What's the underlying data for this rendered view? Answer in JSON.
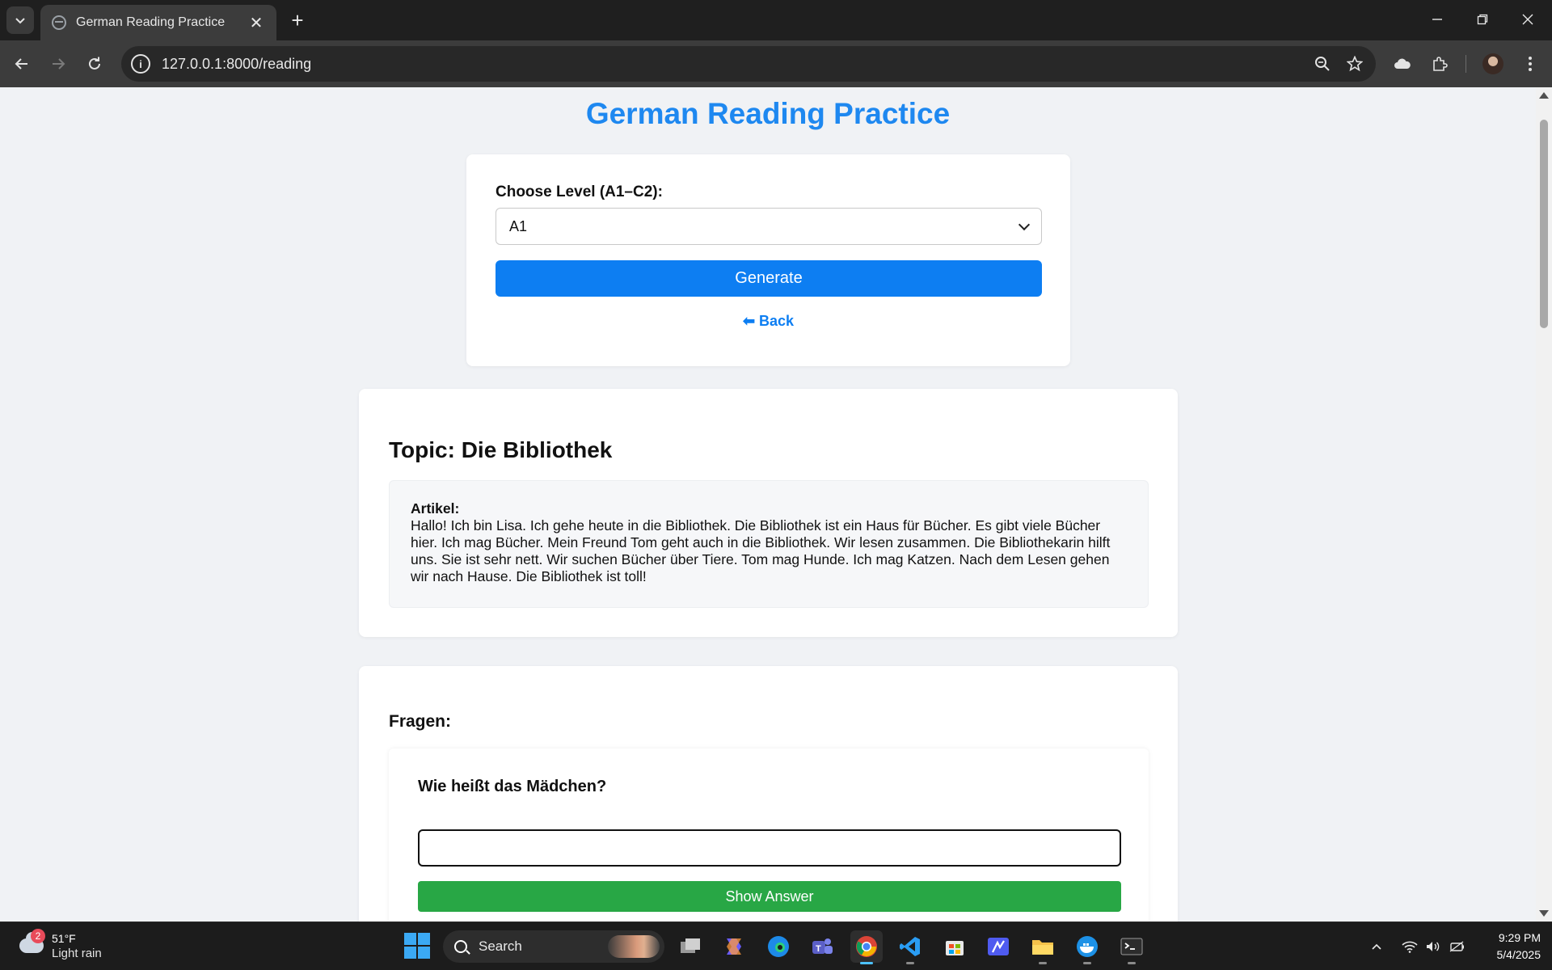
{
  "browser": {
    "tab_title": "German Reading Practice",
    "url": "127.0.0.1:8000/reading"
  },
  "page": {
    "title": "German Reading Practice",
    "level": {
      "label": "Choose Level (A1–C2):",
      "selected": "A1"
    },
    "generate_label": "Generate",
    "back_label": "⬅ Back",
    "topic": "Topic: Die Bibliothek",
    "article_label": "Artikel:",
    "article_text": "Hallo! Ich bin Lisa. Ich gehe heute in die Bibliothek. Die Bibliothek ist ein Haus für Bücher. Es gibt viele Bücher hier. Ich mag Bücher. Mein Freund Tom geht auch in die Bibliothek. Wir lesen zusammen. Die Bibliothekarin hilft uns. Sie ist sehr nett. Wir suchen Bücher über Tiere. Tom mag Hunde. Ich mag Katzen. Nach dem Lesen gehen wir nach Hause. Die Bibliothek ist toll!",
    "questions_heading": "Fragen:",
    "questions": [
      {
        "text": "Wie heißt das Mädchen?",
        "answer_value": "",
        "show_answer_label": "Show Answer"
      }
    ]
  },
  "taskbar": {
    "weather": {
      "badge": "2",
      "temp": "51°F",
      "desc": "Light rain"
    },
    "search_label": "Search",
    "clock": {
      "time": "9:29 PM",
      "date": "5/4/2025"
    }
  },
  "colors": {
    "accent": "#0d7ef2",
    "title": "#1e88f0",
    "success": "#28a745",
    "page_bg": "#f0f2f5"
  }
}
